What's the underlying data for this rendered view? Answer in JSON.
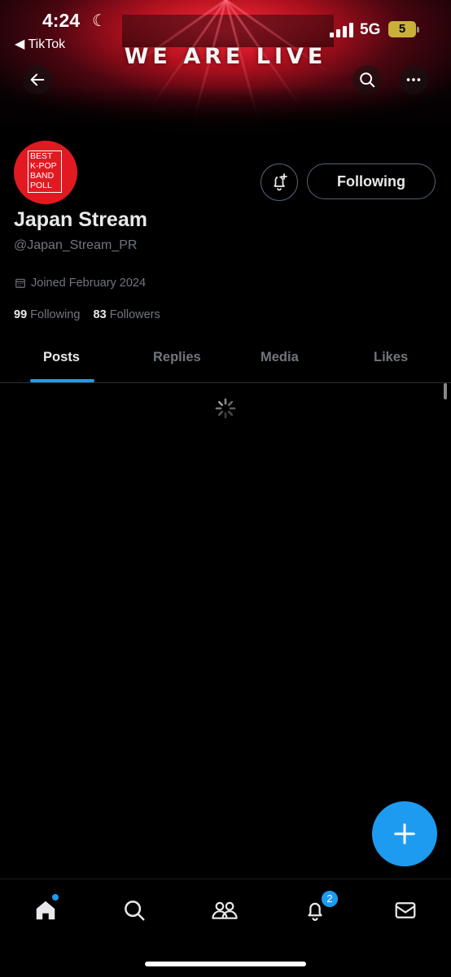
{
  "status_bar": {
    "time": "4:24",
    "back_app": "◀ TikTok",
    "network": "5G",
    "battery": "5"
  },
  "banner": {
    "title": "WE ARE LIVE"
  },
  "avatar": {
    "lines": [
      "BEST",
      "K-POP",
      "BAND",
      "POLL"
    ],
    "bg_color": "#e11a22"
  },
  "profile": {
    "follow_label": "Following",
    "name": "Japan Stream",
    "handle": "@Japan_Stream_PR",
    "joined": "Joined February 2024",
    "following_count": "99",
    "following_label": "Following",
    "followers_count": "83",
    "followers_label": "Followers"
  },
  "tabs": [
    {
      "label": "Posts",
      "active": true
    },
    {
      "label": "Replies",
      "active": false
    },
    {
      "label": "Media",
      "active": false
    },
    {
      "label": "Likes",
      "active": false
    }
  ],
  "notifications_badge": "2",
  "colors": {
    "accent": "#1d9bf0",
    "muted": "#71767b",
    "text": "#e7e9ea"
  }
}
